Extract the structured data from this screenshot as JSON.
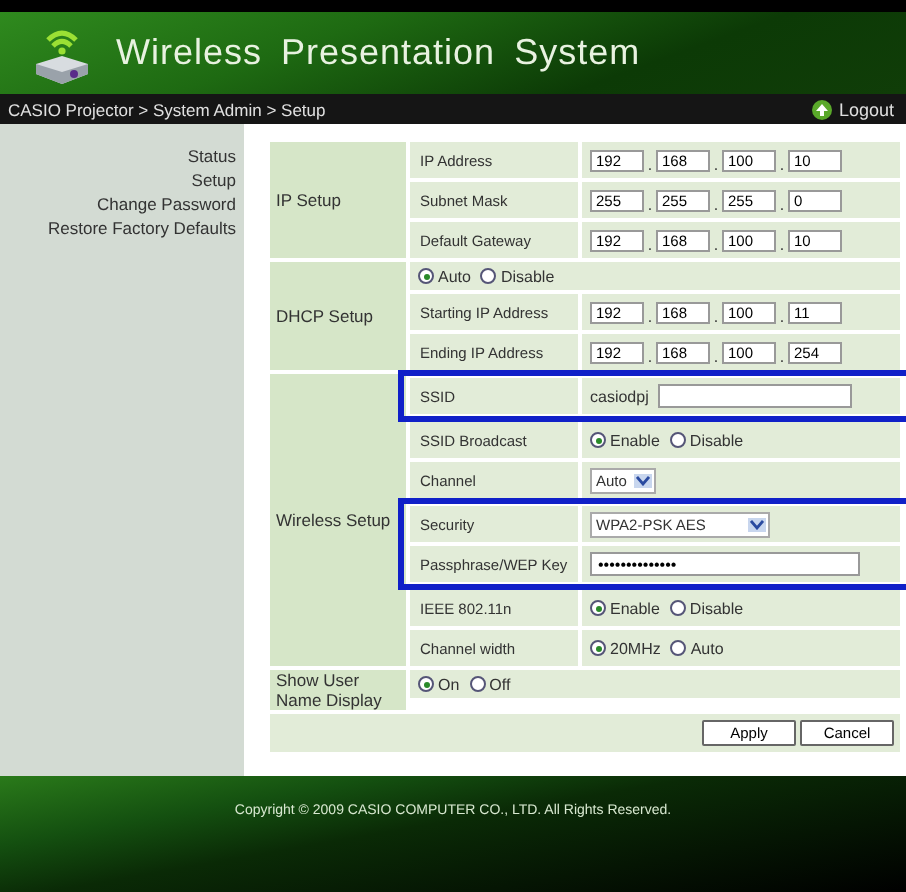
{
  "header": {
    "title": "Wireless Presentation System"
  },
  "breadcrumb": {
    "path": "CASIO Projector > System Admin > Setup",
    "logout": "Logout"
  },
  "sidebar": {
    "items": [
      {
        "label": "Status"
      },
      {
        "label": "Setup"
      },
      {
        "label": "Change Password"
      },
      {
        "label": "Restore Factory Defaults"
      }
    ]
  },
  "sections": [
    {
      "label": "IP Setup",
      "rows": [
        {
          "kind": "ip",
          "label": "IP Address",
          "separator": ".",
          "octets": [
            "192",
            "168",
            "100",
            "10"
          ],
          "highlighted": false
        },
        {
          "kind": "ip",
          "label": "Subnet Mask",
          "separator": ".",
          "octets": [
            "255",
            "255",
            "255",
            "0"
          ],
          "highlighted": false
        },
        {
          "kind": "ip",
          "label": "Default Gateway",
          "separator": ".",
          "octets": [
            "192",
            "168",
            "100",
            "10"
          ],
          "highlighted": false
        }
      ]
    },
    {
      "label": "DHCP Setup",
      "rows": [
        {
          "kind": "radio",
          "options": [
            {
              "label": "Auto",
              "selected": true
            },
            {
              "label": "Disable",
              "selected": false
            }
          ],
          "highlighted": false
        },
        {
          "kind": "ip",
          "label": "Starting IP Address",
          "separator": ".",
          "octets": [
            "192",
            "168",
            "100",
            "11"
          ],
          "highlighted": false
        },
        {
          "kind": "ip",
          "label": "Ending IP Address",
          "separator": ".",
          "octets": [
            "192",
            "168",
            "100",
            "254"
          ],
          "highlighted": false
        }
      ]
    },
    {
      "label": "Wireless Setup",
      "rows": [
        {
          "kind": "text",
          "label": "SSID",
          "prefix": "casiodpj",
          "highlighted": true
        },
        {
          "kind": "radio",
          "label": "SSID Broadcast",
          "options": [
            {
              "label": "Enable",
              "selected": true
            },
            {
              "label": "Disable",
              "selected": false
            }
          ],
          "highlighted": false
        },
        {
          "kind": "select",
          "label": "Channel",
          "value": "Auto",
          "highlighted": false
        },
        {
          "kind": "select",
          "label": "Security",
          "value": "WPA2-PSK AES",
          "highlighted": true
        },
        {
          "kind": "password",
          "label": "Passphrase/WEP Key",
          "value": "••••••••••••••",
          "highlighted": true
        },
        {
          "kind": "radio",
          "label": "IEEE 802.11n",
          "options": [
            {
              "label": "Enable",
              "selected": true
            },
            {
              "label": "Disable",
              "selected": false
            }
          ],
          "highlighted": false
        },
        {
          "kind": "radio",
          "label": "Channel width",
          "options": [
            {
              "label": "20MHz",
              "selected": true
            },
            {
              "label": "Auto",
              "selected": false
            }
          ],
          "highlighted": false
        }
      ]
    },
    {
      "label": "Show User Name Display",
      "rows": [
        {
          "kind": "radio",
          "options": [
            {
              "label": "On",
              "selected": true
            },
            {
              "label": "Off",
              "selected": false
            }
          ],
          "highlighted": false
        }
      ]
    }
  ],
  "buttons": [
    "Apply",
    "Cancel"
  ],
  "footer": {
    "copyright": "Copyright © 2009 CASIO COMPUTER CO., LTD. All Rights Reserved."
  }
}
